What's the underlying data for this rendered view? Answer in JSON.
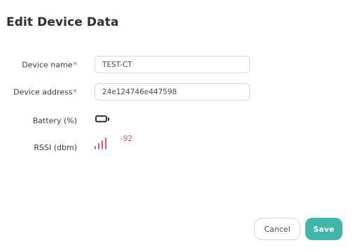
{
  "dialog": {
    "title": "Edit Device Data"
  },
  "form": {
    "device_name": {
      "label": "Device name",
      "required_marker": "*",
      "value": "TEST-CT"
    },
    "device_address": {
      "label": "Device address",
      "required_marker": "*",
      "value": "24e124746e447598"
    },
    "battery": {
      "label": "Battery (%)",
      "icon": "battery-icon"
    },
    "rssi": {
      "label": "RSSI (dbm)",
      "icon": "signal-bars-icon",
      "value": "-92"
    }
  },
  "actions": {
    "cancel_label": "Cancel",
    "save_label": "Save"
  },
  "colors": {
    "accent": "#3fb6a8",
    "rssi": "#ea4f86",
    "required": "#e5484d",
    "text": "#2b2d3a",
    "border": "#d6d8de"
  }
}
